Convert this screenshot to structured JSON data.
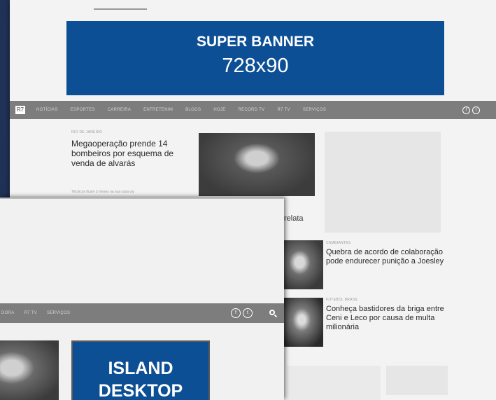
{
  "back_page": {
    "super_banner": {
      "title": "SUPER BANNER",
      "size": "728x90"
    },
    "nav": {
      "logo": "R7",
      "items": [
        "NOTÍCIAS",
        "ESPORTES",
        "CARREIRA",
        "ENTRETENIM",
        "BLOGS",
        "HOJE",
        "RECORD TV",
        "R7 TV",
        "SERVIÇOS"
      ],
      "social": [
        "f",
        "t"
      ]
    },
    "main_article": {
      "kicker": "RIO DE JANEIRO",
      "headline": "Megaoperação prende 14 bombeiros por esquema de venda de alvarás",
      "related": "Técnicos ficam 3 meses na sua casa via"
    },
    "relata_fragment": "relata",
    "side_articles": [
      {
        "kicker": "CAMBIANTES",
        "headline": "Quebra de acordo de colaboração pode endurecer punição a Joesley"
      },
      {
        "kicker": "FUTEBOL BRASIL",
        "headline": "Conheça bastidores da briga entre Ceni e Leco por causa de multa milionária"
      }
    ]
  },
  "front_page": {
    "nav": {
      "items": [
        "DORA",
        "R7 TV",
        "SERVIÇOS"
      ],
      "social": [
        "f",
        "t"
      ]
    },
    "island_banner": {
      "line1": "ISLAND",
      "line2": "DESKTOP"
    }
  }
}
